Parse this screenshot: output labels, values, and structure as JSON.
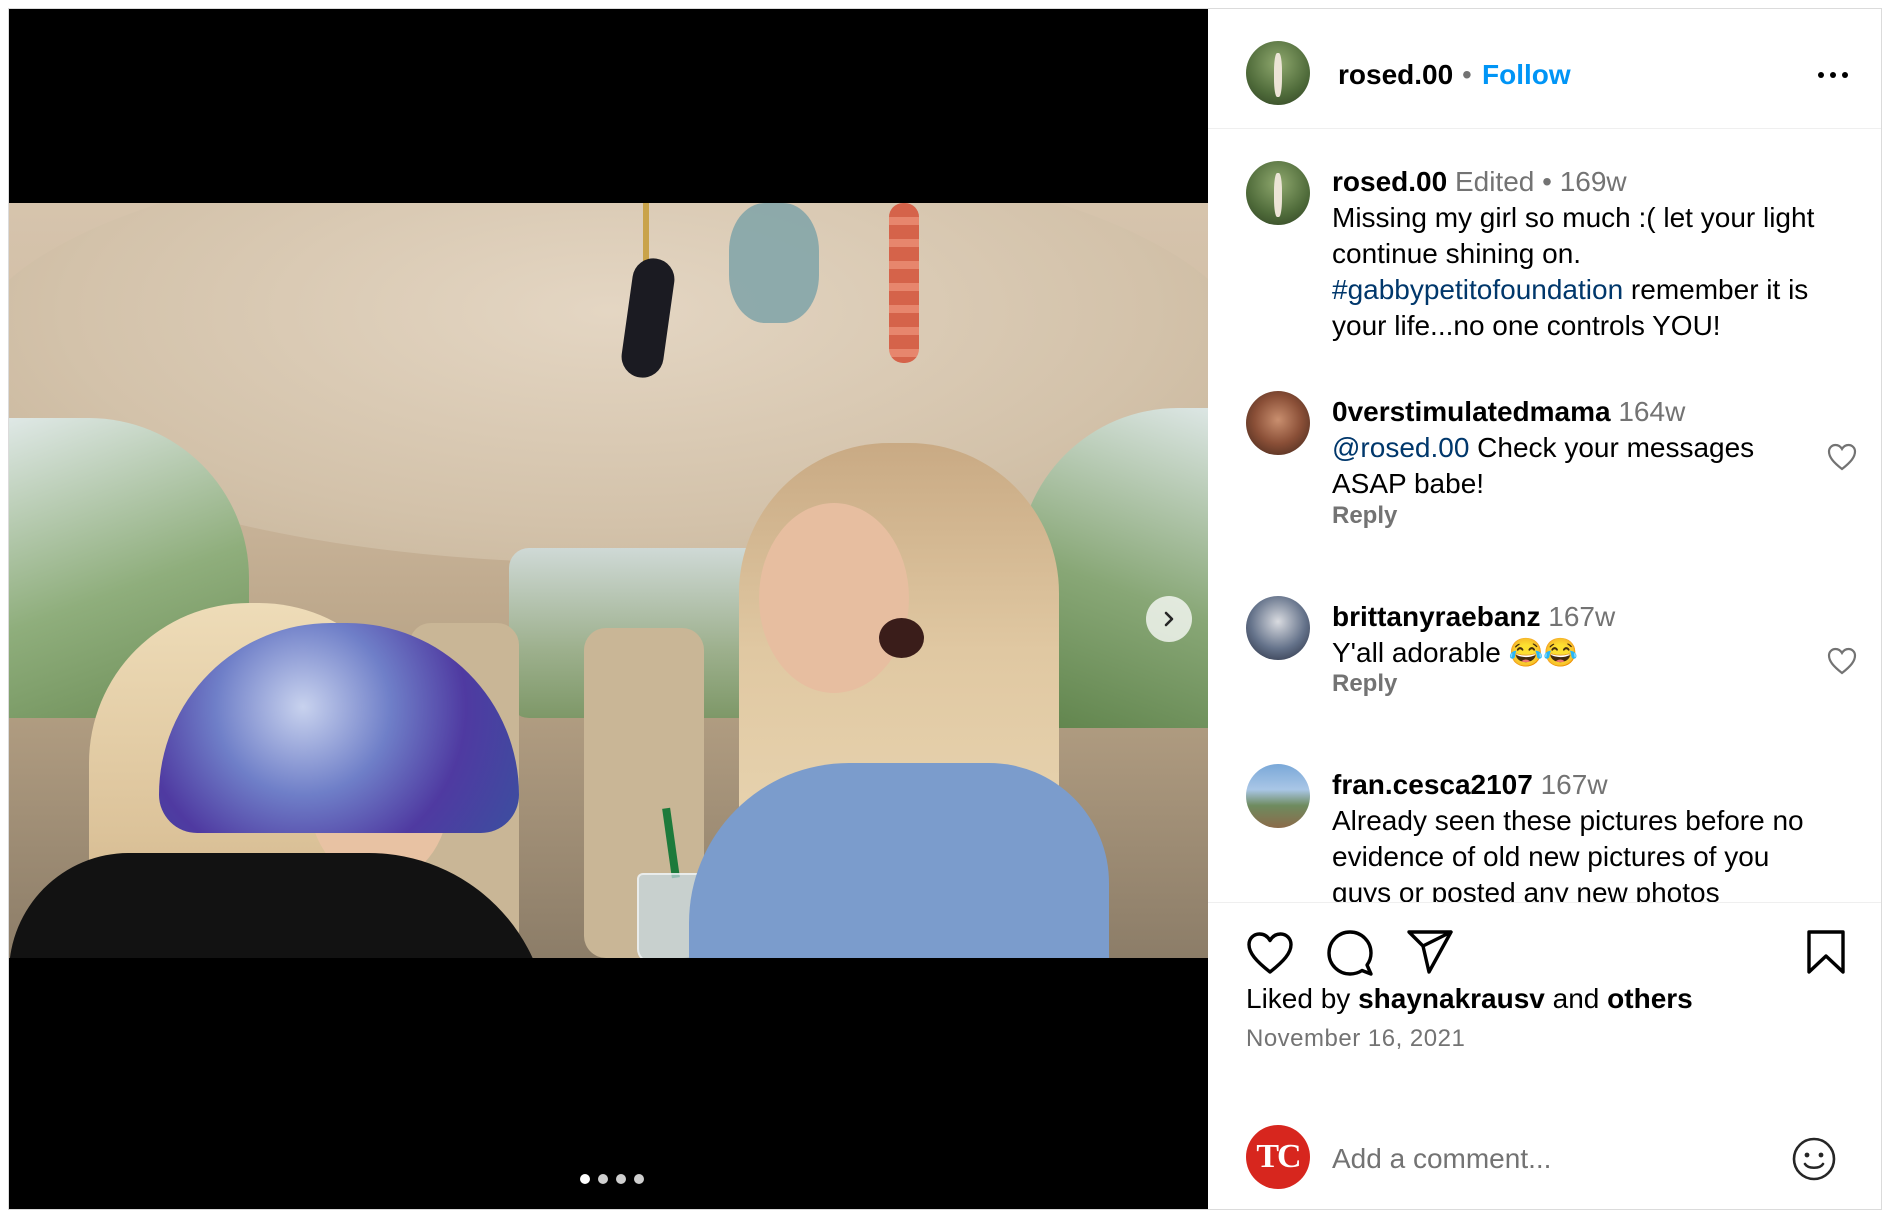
{
  "post": {
    "author": "rosed.00",
    "follow_label": "Follow",
    "separator": "•"
  },
  "caption": {
    "user": "rosed.00",
    "meta": "Edited •  169w",
    "text_before_tag": "Missing my girl so much :( let your light continue shining on. ",
    "hashtag": "#gabbypetitofoundation",
    "text_after_tag": " remember it is your life...no one controls YOU!"
  },
  "comments": [
    {
      "user": "0verstimulatedmama",
      "age": "164w",
      "mention": "@rosed.00",
      "text": " Check your messages ASAP babe!",
      "reply_label": "Reply"
    },
    {
      "user": "brittanyraebanz",
      "age": "167w",
      "mention": "",
      "text": "Y'all adorable 😂😂",
      "reply_label": "Reply"
    },
    {
      "user": "fran.cesca2107",
      "age": "167w",
      "mention": "",
      "text": "Already seen these pictures before no evidence of old new pictures of you guys or posted any new photos",
      "reply_label": ""
    }
  ],
  "likes": {
    "prefix": "Liked by ",
    "user": "shaynakrausv",
    "middle": " and ",
    "others": "others"
  },
  "date": "November 16, 2021",
  "add_comment": {
    "placeholder": "Add a comment...",
    "viewer_avatar_text": "TC"
  },
  "carousel": {
    "dot_count": 4,
    "active_index": 0
  },
  "icons": {
    "more": "more-horizontal-icon",
    "next": "chevron-right-icon",
    "like": "heart-icon",
    "comment": "comment-bubble-icon",
    "share": "paper-plane-icon",
    "save": "bookmark-icon",
    "emoji": "smiley-icon"
  },
  "colors": {
    "accent": "#0095f6",
    "muted": "#737373",
    "hashtag": "#00376b",
    "viewer_logo": "#d7261e"
  }
}
